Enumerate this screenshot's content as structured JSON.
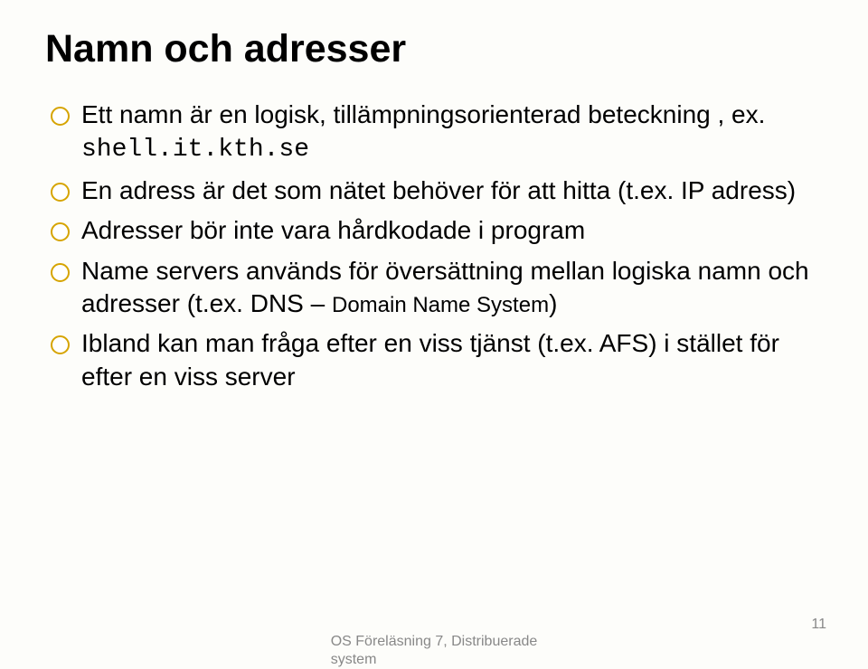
{
  "title": "Namn och adresser",
  "bullets": {
    "b0": {
      "pre": "Ett namn är en logisk, tillämpningsorienterad beteckning , ex. ",
      "mono": "shell.it.kth.se"
    },
    "b1": "En adress är det som nätet behöver för att hitta (t.ex. IP adress)",
    "b2": "Adresser bör inte vara hårdkodade i program",
    "b3": {
      "pre": "Name servers används för översättning mellan logiska namn och adresser (t.ex. DNS – ",
      "small": "Domain Name System",
      "post": ")"
    },
    "b4": "Ibland kan man fråga efter en viss tjänst (t.ex. AFS) i stället för efter en viss server"
  },
  "footer": {
    "line1": "OS Föreläsning 7, Distribuerade",
    "line2": "system",
    "page": "11"
  }
}
